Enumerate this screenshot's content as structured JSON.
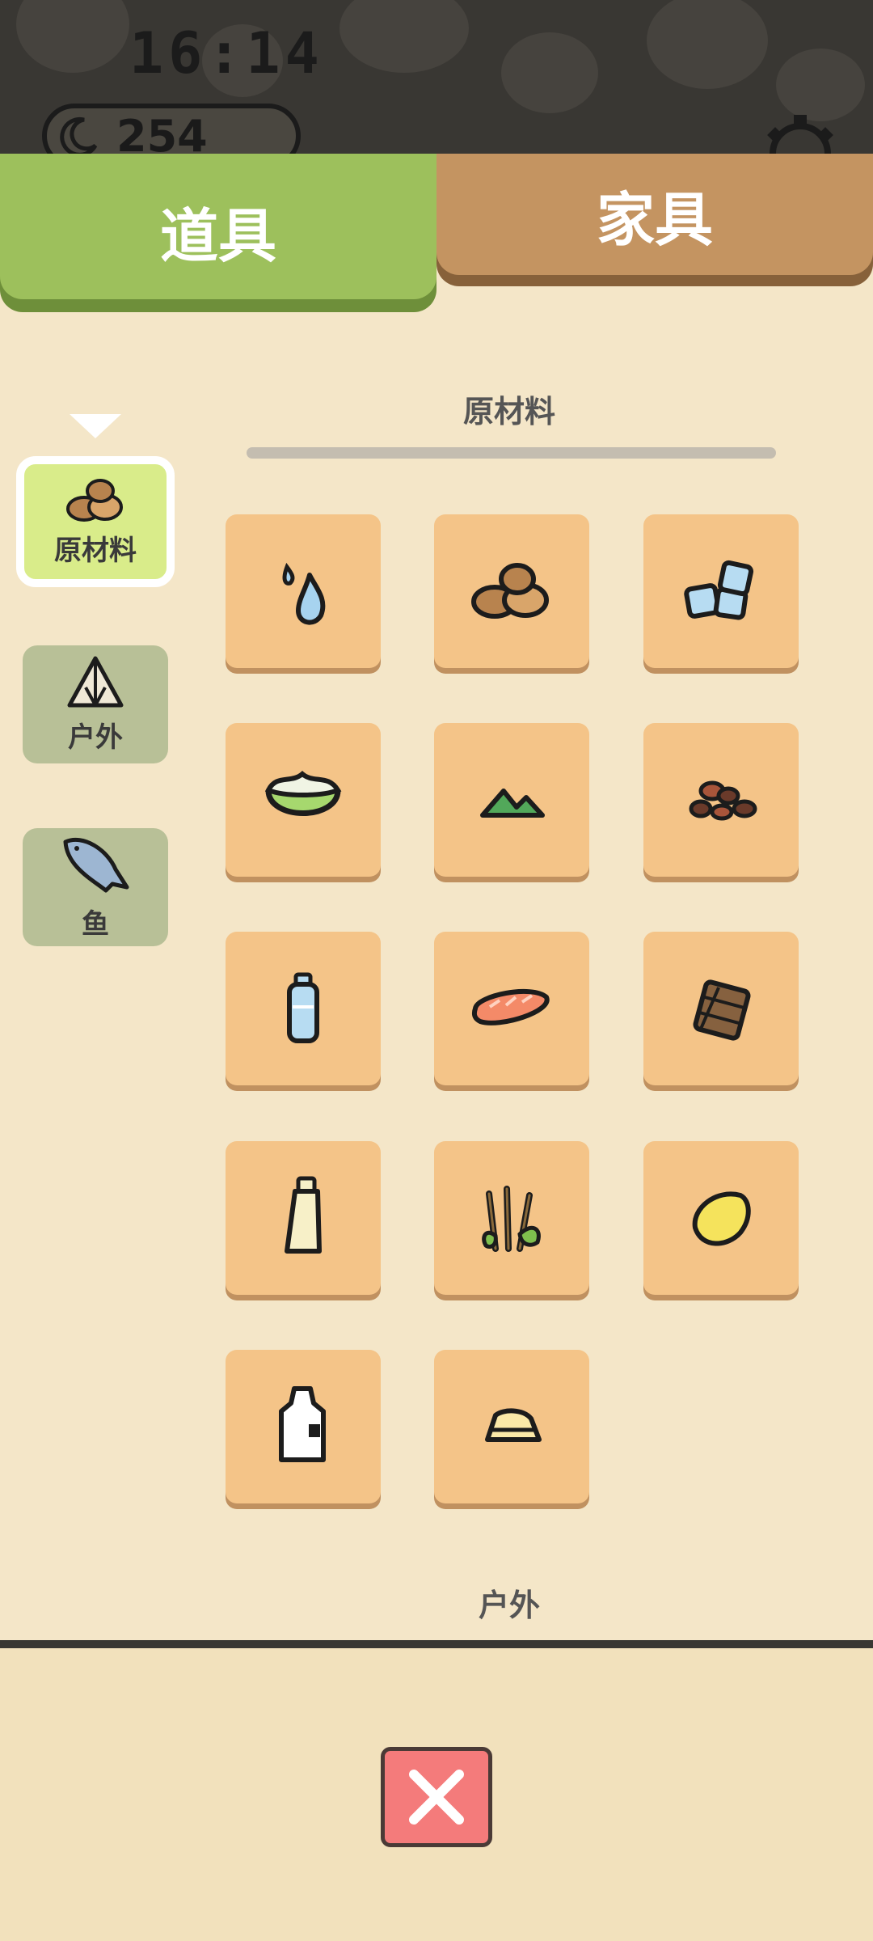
{
  "status": {
    "clock": "16:14",
    "currency_amount": "254",
    "currency_icon": "moon-icon",
    "settings_icon": "gear-icon"
  },
  "tabs": [
    {
      "label": "道具",
      "active": true,
      "color": "#9dc05c"
    },
    {
      "label": "家具",
      "active": false,
      "color": "#c49461"
    }
  ],
  "categories": [
    {
      "label": "原材料",
      "icon": "nuts-icon",
      "active": true
    },
    {
      "label": "户外",
      "icon": "tent-icon",
      "active": false
    },
    {
      "label": "鱼",
      "icon": "fish-icon",
      "active": false
    }
  ],
  "section": {
    "title": "原材料",
    "next_section_title": "户外"
  },
  "items": [
    {
      "icon": "water-drop-icon"
    },
    {
      "icon": "nuts-icon"
    },
    {
      "icon": "ice-cubes-icon"
    },
    {
      "icon": "melon-bowl-icon"
    },
    {
      "icon": "green-leaves-icon"
    },
    {
      "icon": "beans-icon"
    },
    {
      "icon": "water-bottle-icon"
    },
    {
      "icon": "salmon-slice-icon"
    },
    {
      "icon": "chocolate-bar-icon"
    },
    {
      "icon": "oil-bottle-icon"
    },
    {
      "icon": "herbs-icon"
    },
    {
      "icon": "lemon-icon"
    },
    {
      "icon": "milk-jug-icon"
    },
    {
      "icon": "cake-slice-icon"
    }
  ],
  "colors": {
    "background": "#f4e6c8",
    "tile": "#f4c488",
    "close_button": "#f47b7b"
  },
  "close_button": {
    "icon": "close-icon"
  }
}
